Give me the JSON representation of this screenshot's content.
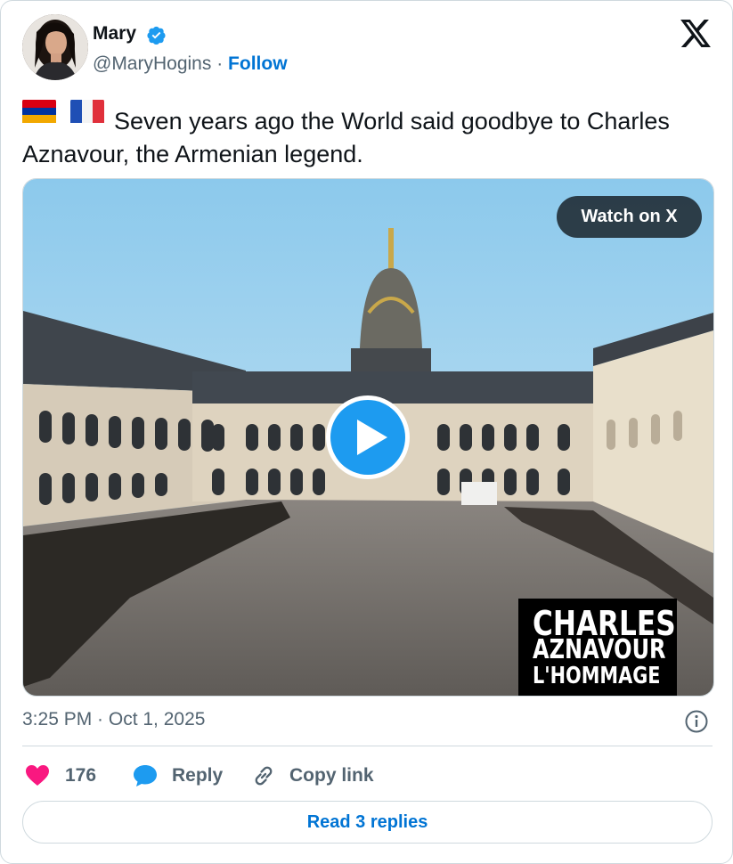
{
  "author": {
    "name": "Mary",
    "handle": "@MaryHogins",
    "separator": "·",
    "follow_label": "Follow"
  },
  "icons": {
    "verified": "verified-badge-icon",
    "brand": "x-logo-icon",
    "flag1": "armenia-flag-icon",
    "flag2": "france-flag-icon",
    "play": "play-icon",
    "info": "info-icon",
    "like": "heart-icon",
    "reply": "reply-bubble-icon",
    "copy": "link-icon"
  },
  "tweet": {
    "text": "Seven years ago the World said goodbye to Charles Aznavour, the Armenian legend."
  },
  "media": {
    "watch_label": "Watch on X",
    "overlay_line1": "CHARLES",
    "overlay_line2": "AZNAVOUR",
    "overlay_line3": "L'HOMMAGE"
  },
  "meta": {
    "timestamp": "3:25 PM · Oct 1, 2025"
  },
  "actions": {
    "like_count": "176",
    "reply_label": "Reply",
    "copy_label": "Copy link"
  },
  "footer": {
    "read_replies_label": "Read 3 replies"
  },
  "colors": {
    "accent": "#0074d4",
    "like": "#f91880",
    "verified": "#1d9bf0",
    "play": "#1d9bf0"
  }
}
